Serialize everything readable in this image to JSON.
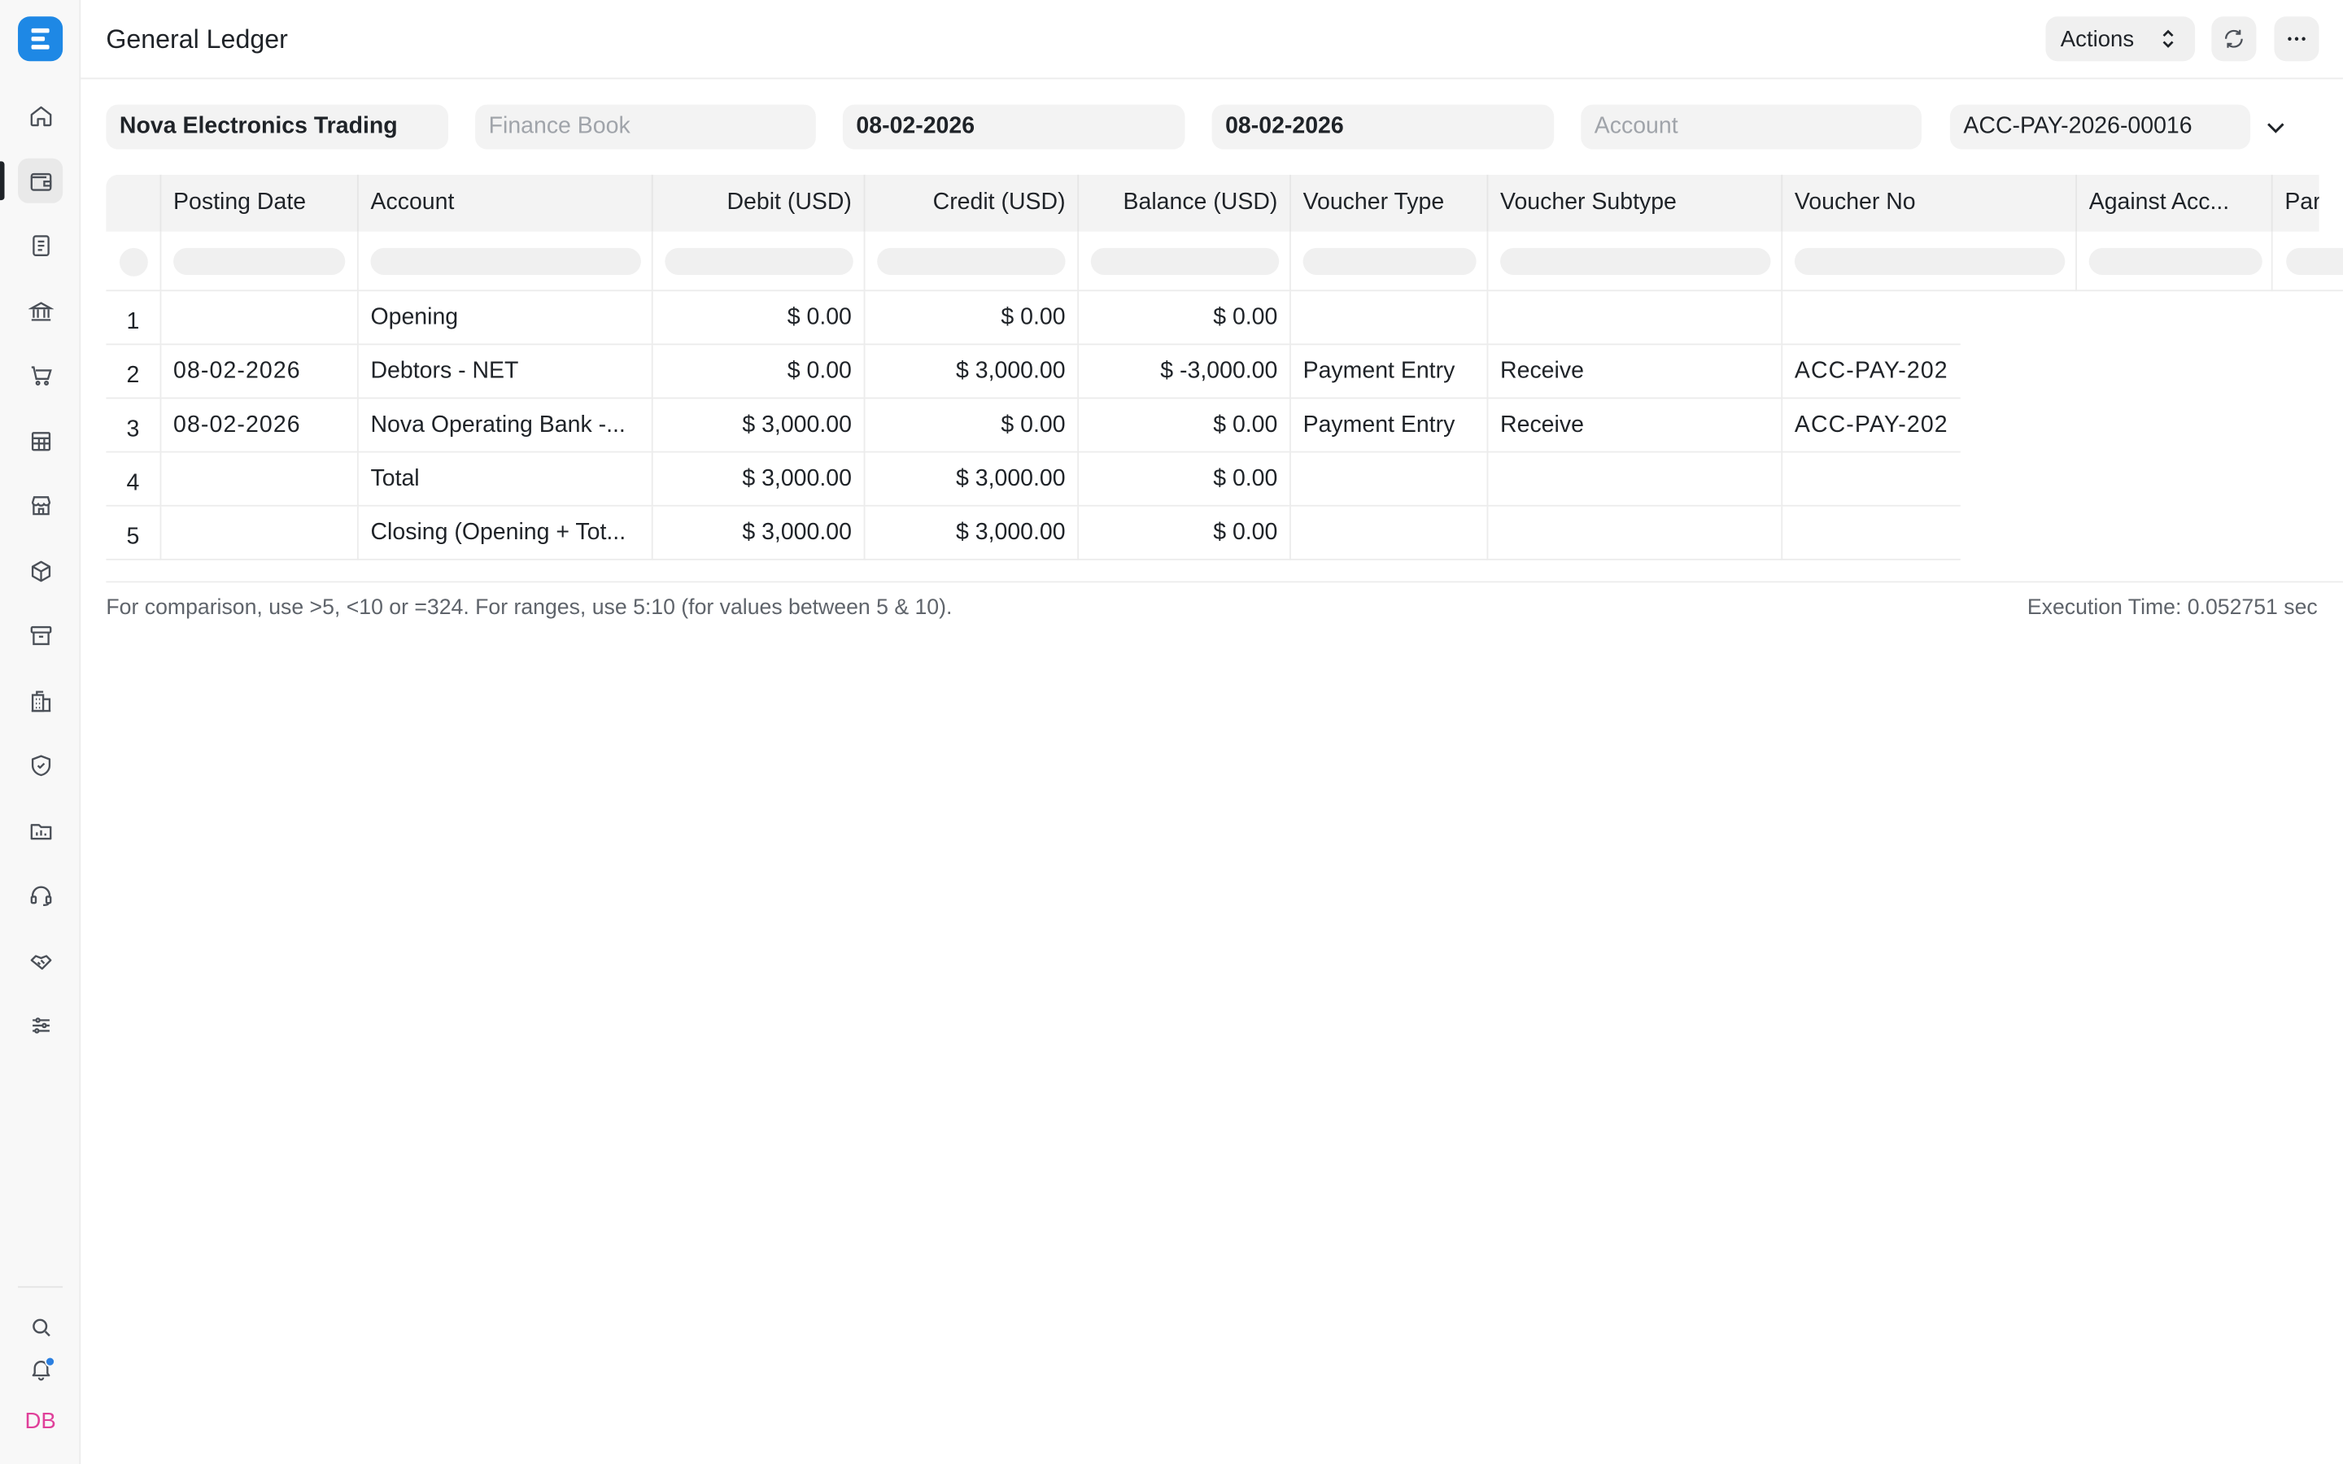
{
  "app": {
    "title": "General Ledger",
    "actions_label": "Actions",
    "avatar_initials": "DB",
    "accent_color": "#1e88e5"
  },
  "sidebar": {
    "items": [
      {
        "icon": "home-icon"
      },
      {
        "icon": "wallet-icon",
        "active": true
      },
      {
        "icon": "document-icon"
      },
      {
        "icon": "bank-icon"
      },
      {
        "icon": "cart-icon"
      },
      {
        "icon": "table-icon"
      },
      {
        "icon": "store-icon"
      },
      {
        "icon": "box-icon"
      },
      {
        "icon": "archive-icon"
      },
      {
        "icon": "building-icon"
      },
      {
        "icon": "shield-icon"
      },
      {
        "icon": "folder-chart-icon"
      },
      {
        "icon": "headset-icon"
      },
      {
        "icon": "handshake-icon"
      },
      {
        "icon": "sliders-icon"
      }
    ],
    "bottom": [
      "search-icon",
      "bell-icon"
    ]
  },
  "filters": {
    "company": "Nova Electronics Trading",
    "finance_book_placeholder": "Finance Book",
    "from_date": "08-02-2026",
    "to_date": "08-02-2026",
    "account_placeholder": "Account",
    "voucher_no": "ACC-PAY-2026-00016"
  },
  "table": {
    "columns": [
      "Posting Date",
      "Account",
      "Debit (USD)",
      "Credit (USD)",
      "Balance (USD)",
      "Voucher Type",
      "Voucher Subtype",
      "Voucher No",
      "Against Acc...",
      "Par"
    ],
    "rows": [
      {
        "idx": "1",
        "posting_date": "",
        "account": "Opening",
        "debit": "$ 0.00",
        "credit": "$ 0.00",
        "balance": "$ 0.00",
        "voucher_type": "",
        "voucher_subtype": "",
        "voucher_no": ""
      },
      {
        "idx": "2",
        "posting_date": "08-02-2026",
        "account": "Debtors - NET",
        "debit": "$ 0.00",
        "credit": "$ 3,000.00",
        "balance": "$ -3,000.00",
        "voucher_type": "Payment Entry",
        "voucher_subtype": "Receive",
        "voucher_no": "ACC-PAY-202"
      },
      {
        "idx": "3",
        "posting_date": "08-02-2026",
        "account": "Nova Operating Bank -...",
        "debit": "$ 3,000.00",
        "credit": "$ 0.00",
        "balance": "$ 0.00",
        "voucher_type": "Payment Entry",
        "voucher_subtype": "Receive",
        "voucher_no": "ACC-PAY-202"
      },
      {
        "idx": "4",
        "posting_date": "",
        "account": "Total",
        "debit": "$ 3,000.00",
        "credit": "$ 3,000.00",
        "balance": "$ 0.00",
        "voucher_type": "",
        "voucher_subtype": "",
        "voucher_no": ""
      },
      {
        "idx": "5",
        "posting_date": "",
        "account": "Closing (Opening + Tot...",
        "debit": "$ 3,000.00",
        "credit": "$ 3,000.00",
        "balance": "$ 0.00",
        "voucher_type": "",
        "voucher_subtype": "",
        "voucher_no": ""
      }
    ]
  },
  "footer": {
    "hint": "For comparison, use >5, <10 or =324. For ranges, use 5:10 (for values between 5 & 10).",
    "execution_time": "Execution Time: 0.052751 sec"
  }
}
